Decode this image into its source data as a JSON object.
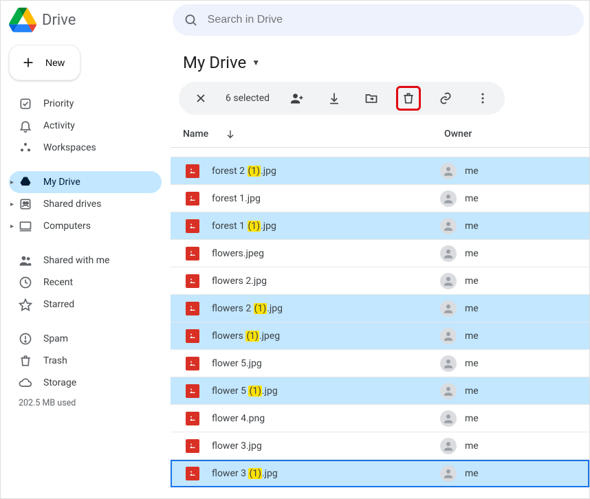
{
  "header": {
    "brand": "Drive",
    "search_placeholder": "Search in Drive"
  },
  "sidebar": {
    "new_label": "New",
    "items": [
      {
        "id": "priority",
        "label": "Priority",
        "icon": "priority-icon"
      },
      {
        "id": "activity",
        "label": "Activity",
        "icon": "bell-icon"
      },
      {
        "id": "workspaces",
        "label": "Workspaces",
        "icon": "workspaces-icon"
      }
    ],
    "drives": [
      {
        "id": "my-drive",
        "label": "My Drive",
        "expandable": true,
        "active": true,
        "icon": "drive-icon"
      },
      {
        "id": "shared-drives",
        "label": "Shared drives",
        "expandable": true,
        "icon": "shared-drives-icon"
      },
      {
        "id": "computers",
        "label": "Computers",
        "expandable": true,
        "icon": "computers-icon"
      }
    ],
    "other": [
      {
        "id": "shared",
        "label": "Shared with me",
        "icon": "people-icon"
      },
      {
        "id": "recent",
        "label": "Recent",
        "icon": "clock-icon"
      },
      {
        "id": "starred",
        "label": "Starred",
        "icon": "star-icon"
      }
    ],
    "bottom": [
      {
        "id": "spam",
        "label": "Spam",
        "icon": "spam-icon"
      },
      {
        "id": "trash",
        "label": "Trash",
        "icon": "trash-icon"
      },
      {
        "id": "storage",
        "label": "Storage",
        "icon": "cloud-icon"
      }
    ],
    "storage_sub": "202.5 MB used"
  },
  "main": {
    "title": "My Drive",
    "selection_count_label": "6 selected",
    "columns": {
      "name": "Name",
      "owner": "Owner"
    },
    "owner_label": "me",
    "files": [
      {
        "name_pre": "forest 2 ",
        "name_hl": "(1)",
        "name_post": ".jpg",
        "selected": true
      },
      {
        "name_pre": "forest 1.jpg",
        "name_hl": "",
        "name_post": "",
        "selected": false
      },
      {
        "name_pre": "forest 1 ",
        "name_hl": "(1)",
        "name_post": ".jpg",
        "selected": true
      },
      {
        "name_pre": "flowers.jpeg",
        "name_hl": "",
        "name_post": "",
        "selected": false
      },
      {
        "name_pre": "flowers 2.jpg",
        "name_hl": "",
        "name_post": "",
        "selected": false
      },
      {
        "name_pre": "flowers 2 ",
        "name_hl": "(1)",
        "name_post": ".jpg",
        "selected": true
      },
      {
        "name_pre": "flowers ",
        "name_hl": "(1)",
        "name_post": ".jpeg",
        "selected": true
      },
      {
        "name_pre": "flower 5.jpg",
        "name_hl": "",
        "name_post": "",
        "selected": false
      },
      {
        "name_pre": "flower 5 ",
        "name_hl": "(1)",
        "name_post": ".jpg",
        "selected": true
      },
      {
        "name_pre": "flower 4.png",
        "name_hl": "",
        "name_post": "",
        "selected": false
      },
      {
        "name_pre": "flower 3.jpg",
        "name_hl": "",
        "name_post": "",
        "selected": false
      },
      {
        "name_pre": "flower 3 ",
        "name_hl": "(1)",
        "name_post": ".jpg",
        "selected": true,
        "focused": true
      }
    ]
  }
}
